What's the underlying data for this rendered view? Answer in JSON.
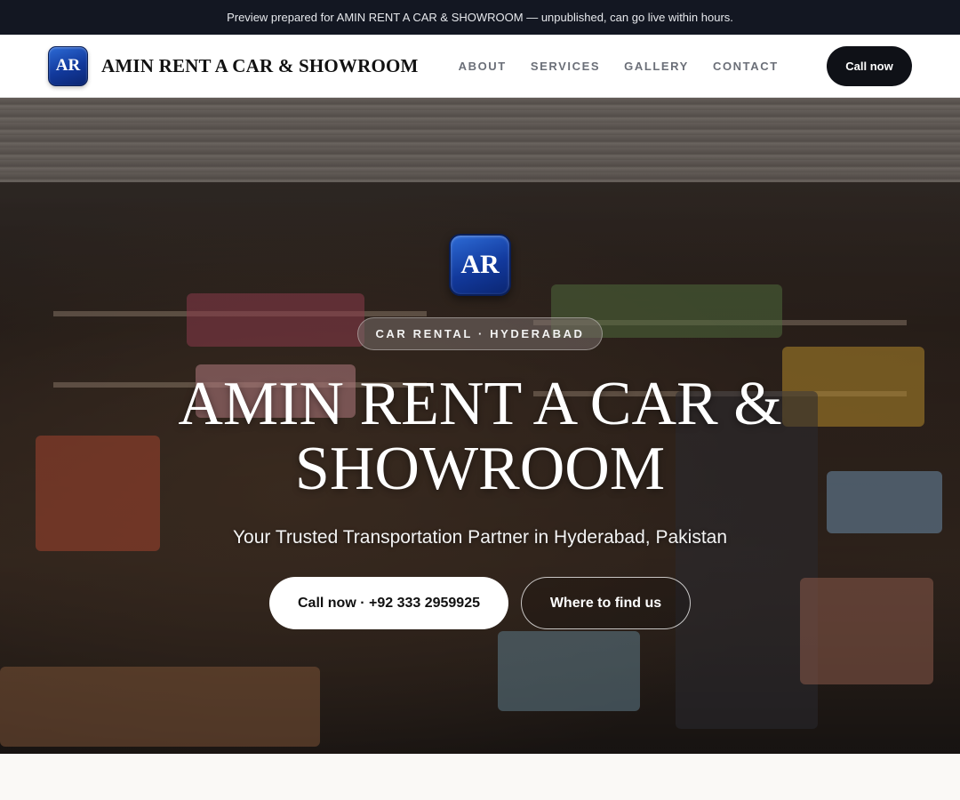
{
  "preview_bar": {
    "text": "Preview prepared for AMIN RENT A CAR & SHOWROOM — unpublished, can go live within hours."
  },
  "navbar": {
    "logo_initials": "AR",
    "brand_name": "AMIN RENT A CAR & SHOWROOM",
    "links": [
      {
        "label": "ABOUT"
      },
      {
        "label": "SERVICES"
      },
      {
        "label": "GALLERY"
      },
      {
        "label": "CONTACT"
      }
    ],
    "cta_label": "Call now"
  },
  "hero": {
    "logo_initials": "AR",
    "eyebrow": "CAR RENTAL · HYDERABAD",
    "title": "AMIN RENT A CAR & SHOWROOM",
    "subtitle": "Your Trusted Transportation Partner in Hyderabad, Pakistan",
    "primary_button": "Call now · +92 333 2959925",
    "secondary_button": "Where to find us"
  }
}
